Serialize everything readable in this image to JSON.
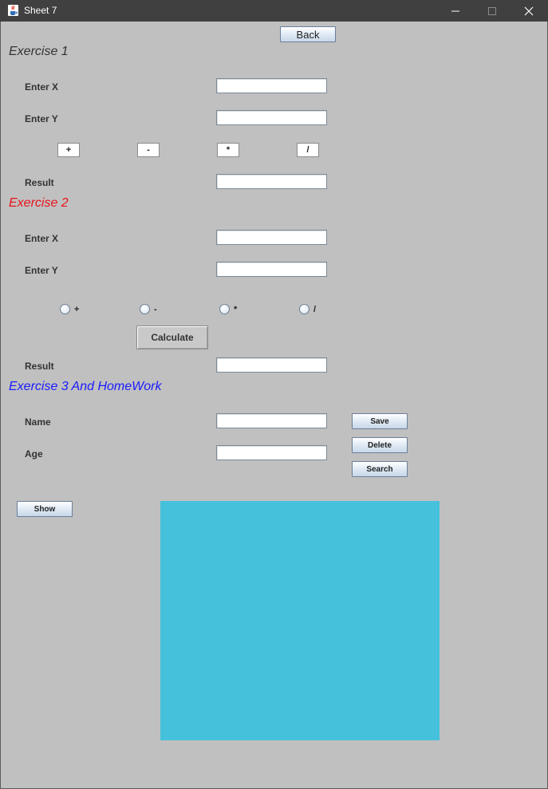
{
  "window": {
    "title": "Sheet 7",
    "controls": {
      "minimize": "–",
      "maximize": "□",
      "close": "✕"
    }
  },
  "back_label": "Back",
  "exercise1": {
    "heading": "Exercise 1",
    "heading_color": "#333333",
    "x_label": "Enter X",
    "y_label": "Enter Y",
    "x_value": "",
    "y_value": "",
    "ops": [
      "+",
      "-",
      "*",
      "/"
    ],
    "result_label": "Result",
    "result_value": ""
  },
  "exercise2": {
    "heading": "Exercise 2",
    "heading_color": "#e8141c",
    "x_label": "Enter X",
    "y_label": "Enter Y",
    "x_value": "",
    "y_value": "",
    "radio_options": [
      "+",
      "-",
      "*",
      "/"
    ],
    "calculate_label": "Calculate",
    "result_label": "Result",
    "result_value": ""
  },
  "exercise3": {
    "heading": "Exercise 3 And HomeWork",
    "heading_color": "#1a1aff",
    "name_label": "Name",
    "age_label": "Age",
    "name_value": "",
    "age_value": "",
    "save_label": "Save",
    "delete_label": "Delete",
    "search_label": "Search",
    "show_label": "Show"
  },
  "colors": {
    "background": "#c0c0c0",
    "titlebar": "#404040",
    "panel": "#45c1db"
  },
  "icons": {
    "app": "java-coffee-cup-icon"
  }
}
